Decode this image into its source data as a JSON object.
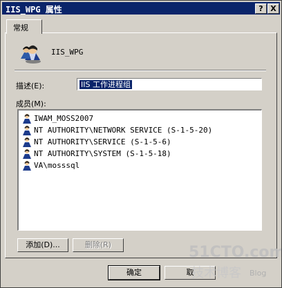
{
  "window": {
    "title": "IIS_WPG 属性",
    "help_btn": "?",
    "close_btn": "X"
  },
  "tabs": [
    {
      "label": "常规"
    }
  ],
  "group": {
    "name": "IIS_WPG"
  },
  "description": {
    "label": "描述(E):",
    "value": "IIS 工作进程组"
  },
  "members": {
    "label": "成员(M):",
    "items": [
      {
        "name": "IWAM_MOSS2007"
      },
      {
        "name": "NT AUTHORITY\\NETWORK SERVICE (S-1-5-20)"
      },
      {
        "name": "NT AUTHORITY\\SERVICE (S-1-5-6)"
      },
      {
        "name": "NT AUTHORITY\\SYSTEM (S-1-5-18)"
      },
      {
        "name": "VA\\mosssql"
      }
    ]
  },
  "buttons": {
    "add": "添加(D)...",
    "remove": "删除(R)",
    "ok": "确定",
    "cancel": "取"
  },
  "watermark": {
    "line1": "51CTO.com",
    "line2": "技术博客",
    "line3": "Blog"
  }
}
